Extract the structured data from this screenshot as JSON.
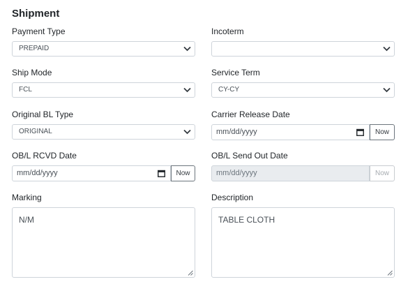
{
  "section_title": "Shipment",
  "fields": {
    "payment_type": {
      "label": "Payment Type",
      "value": "PREPAID"
    },
    "incoterm": {
      "label": "Incoterm",
      "value": ""
    },
    "ship_mode": {
      "label": "Ship Mode",
      "value": "FCL"
    },
    "service_term": {
      "label": "Service Term",
      "value": "CY-CY"
    },
    "original_bl_type": {
      "label": "Original BL Type",
      "value": "ORIGINAL"
    },
    "carrier_release_date": {
      "label": "Carrier Release Date",
      "placeholder": "mm/dd/yyyy",
      "now_label": "Now"
    },
    "obl_rcvd_date": {
      "label": "OB/L RCVD Date",
      "placeholder": "mm/dd/yyyy",
      "now_label": "Now"
    },
    "obl_send_out_date": {
      "label": "OB/L Send Out Date",
      "placeholder": "mm/dd/yyyy",
      "now_label": "Now",
      "disabled": true
    },
    "marking": {
      "label": "Marking",
      "value": "N/M"
    },
    "description": {
      "label": "Description",
      "value": "TABLE CLOTH"
    }
  },
  "icons": {
    "select_arrow": "chevron-down-icon",
    "date_picker": "calendar-icon",
    "resize": "resize-grip-icon"
  }
}
